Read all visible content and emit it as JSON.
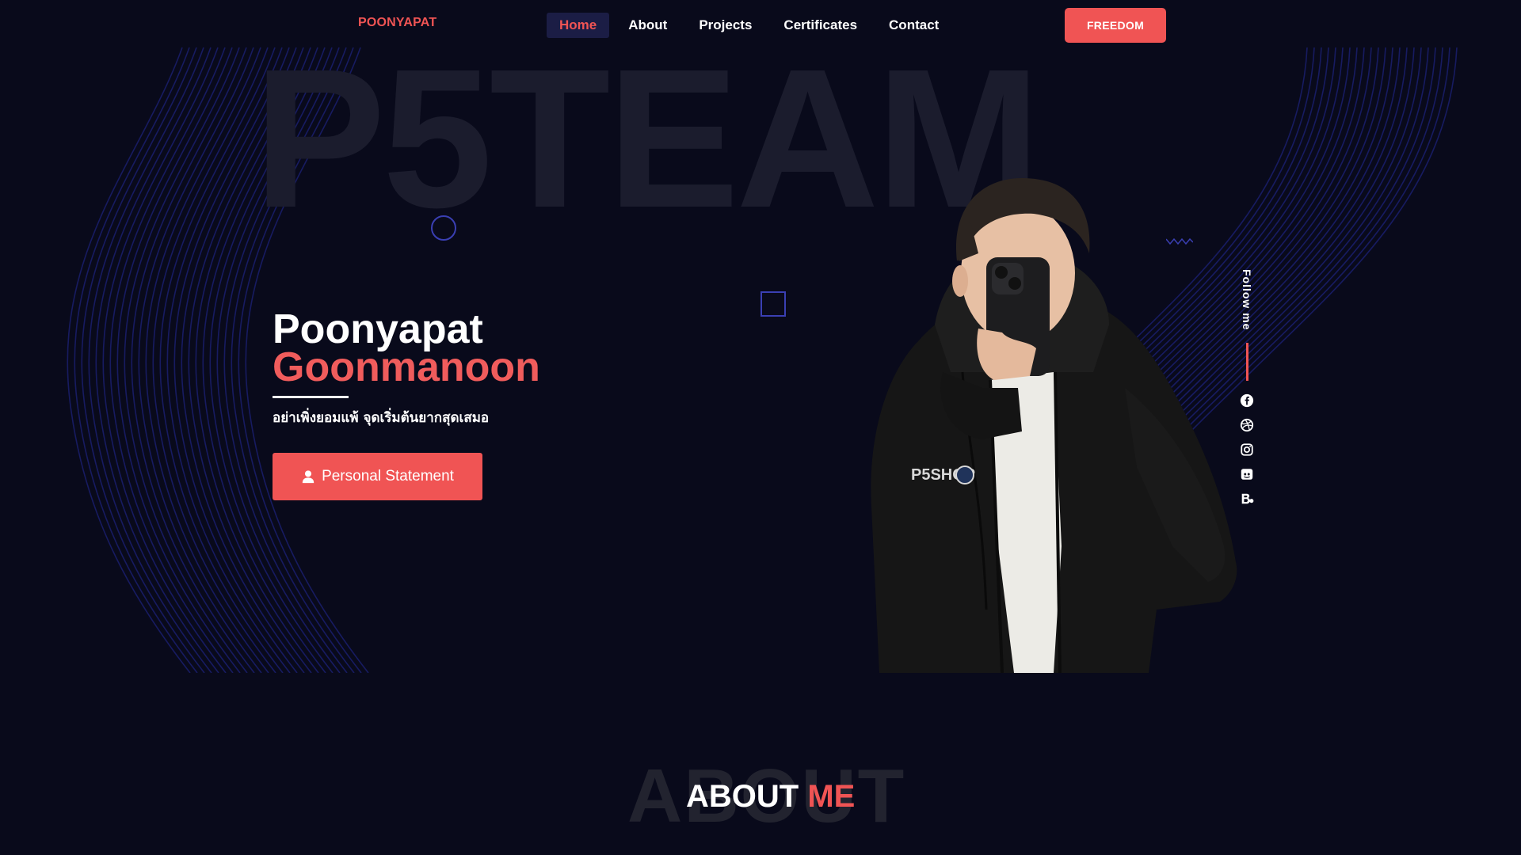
{
  "header": {
    "logo": "POONYAPAT",
    "nav": [
      {
        "label": "Home",
        "active": true
      },
      {
        "label": "About",
        "active": false
      },
      {
        "label": "Projects",
        "active": false
      },
      {
        "label": "Certificates",
        "active": false
      },
      {
        "label": "Contact",
        "active": false
      }
    ],
    "cta_label": "FREEDOM"
  },
  "hero": {
    "watermark": "P5TEAM",
    "first_name": "Poonyapat",
    "last_name": "Goonmanoon",
    "tagline": "อย่าเพิ่งยอมแพ้ จุดเริ่มต้นยากสุดเสมอ",
    "button_label": "Personal Statement",
    "button_icon": "user-icon",
    "hoodie_print": "P5SHOP"
  },
  "follow": {
    "label": "Follow me",
    "icons": [
      "facebook-icon",
      "dribbble-icon",
      "instagram-icon",
      "discord-icon",
      "behance-icon"
    ]
  },
  "about": {
    "watermark": "ABOUT",
    "title_word1": "ABOUT",
    "title_word2": "ME"
  },
  "colors": {
    "background": "#090a1b",
    "accent": "#f05454",
    "nav_active_bg": "#1b1d45",
    "wave": "#1a1f6e"
  }
}
